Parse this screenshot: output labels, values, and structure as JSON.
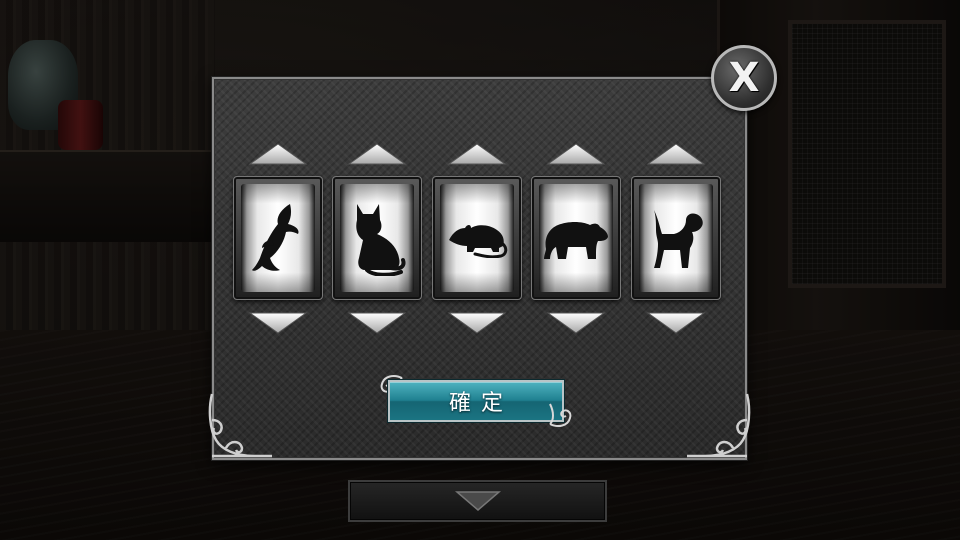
{
  "dialog": {
    "close_glyph": "X",
    "confirm_label": "確定",
    "accent_color": "#1f8090"
  },
  "reels": [
    {
      "animal": "fish",
      "icon": "fish-icon"
    },
    {
      "animal": "cat",
      "icon": "cat-icon"
    },
    {
      "animal": "rat",
      "icon": "rat-icon"
    },
    {
      "animal": "bear",
      "icon": "bear-icon"
    },
    {
      "animal": "dog",
      "icon": "dog-icon"
    }
  ],
  "bottom_tab": {
    "icon": "chevron-down-icon"
  }
}
